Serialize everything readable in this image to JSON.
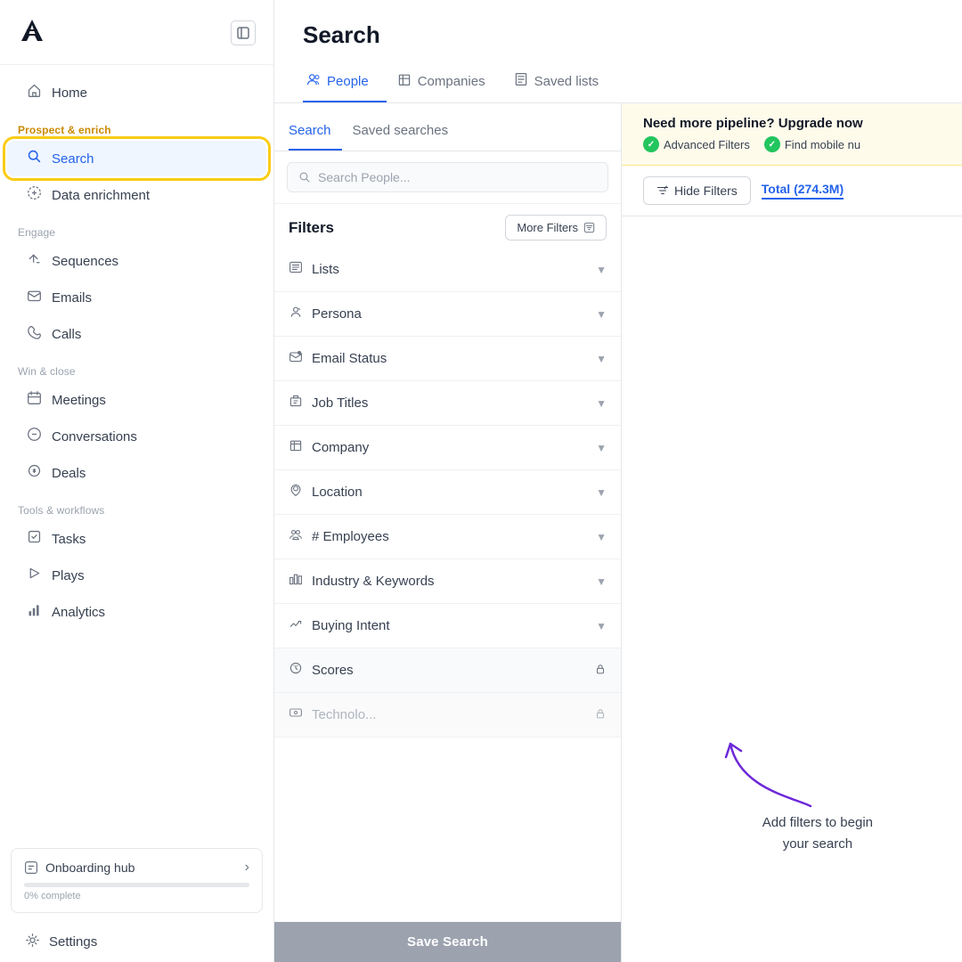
{
  "app": {
    "logo": "A",
    "collapse_icon": "⊟"
  },
  "sidebar": {
    "nav_items": [
      {
        "id": "home",
        "label": "Home",
        "icon": "🏠",
        "section": null,
        "active": false
      },
      {
        "id": "search",
        "label": "Search",
        "icon": "🔍",
        "section": "Prospect & enrich",
        "section_highlight": true,
        "active": true
      },
      {
        "id": "data-enrichment",
        "label": "Data enrichment",
        "icon": "🔄",
        "section": null,
        "active": false
      },
      {
        "id": "sequences",
        "label": "Sequences",
        "icon": "▷",
        "section": "Engage",
        "active": false
      },
      {
        "id": "emails",
        "label": "Emails",
        "icon": "✉",
        "section": null,
        "active": false
      },
      {
        "id": "calls",
        "label": "Calls",
        "icon": "📞",
        "section": null,
        "active": false
      },
      {
        "id": "meetings",
        "label": "Meetings",
        "icon": "📅",
        "section": "Win & close",
        "active": false
      },
      {
        "id": "conversations",
        "label": "Conversations",
        "icon": "💬",
        "section": null,
        "active": false
      },
      {
        "id": "deals",
        "label": "Deals",
        "icon": "$",
        "section": null,
        "active": false
      },
      {
        "id": "tasks",
        "label": "Tasks",
        "icon": "☑",
        "section": "Tools & workflows",
        "active": false
      },
      {
        "id": "plays",
        "label": "Plays",
        "icon": "⚡",
        "section": null,
        "active": false
      },
      {
        "id": "analytics",
        "label": "Analytics",
        "icon": "📊",
        "section": null,
        "active": false
      }
    ],
    "onboarding": {
      "title": "Onboarding hub",
      "progress": 0,
      "progress_label": "0% complete",
      "arrow": "›"
    },
    "settings": {
      "label": "Settings",
      "icon": "⚙"
    }
  },
  "main": {
    "page_title": "Search",
    "tabs": [
      {
        "id": "people",
        "label": "People",
        "icon": "👥",
        "active": true
      },
      {
        "id": "companies",
        "label": "Companies",
        "icon": "🏢",
        "active": false
      },
      {
        "id": "saved-lists",
        "label": "Saved lists",
        "icon": "📋",
        "active": false
      }
    ]
  },
  "filter_panel": {
    "subtabs": [
      {
        "id": "search",
        "label": "Search",
        "active": true
      },
      {
        "id": "saved-searches",
        "label": "Saved searches",
        "active": false
      }
    ],
    "search_placeholder": "Search People...",
    "filters_title": "Filters",
    "more_filters_btn": "More Filters",
    "filters": [
      {
        "id": "lists",
        "label": "Lists",
        "icon": "📋",
        "lock": false
      },
      {
        "id": "persona",
        "label": "Persona",
        "icon": "👤",
        "lock": false
      },
      {
        "id": "email-status",
        "label": "Email Status",
        "icon": "📧",
        "lock": false
      },
      {
        "id": "job-titles",
        "label": "Job Titles",
        "icon": "🏷",
        "lock": false
      },
      {
        "id": "company",
        "label": "Company",
        "icon": "🏢",
        "lock": false
      },
      {
        "id": "location",
        "label": "Location",
        "icon": "📍",
        "lock": false
      },
      {
        "id": "employees",
        "label": "# Employees",
        "icon": "👥",
        "lock": false
      },
      {
        "id": "industry",
        "label": "Industry & Keywords",
        "icon": "🏭",
        "lock": false
      },
      {
        "id": "buying-intent",
        "label": "Buying Intent",
        "icon": "📈",
        "lock": false
      },
      {
        "id": "scores",
        "label": "Scores",
        "icon": "🎯",
        "lock": true
      },
      {
        "id": "technologies",
        "label": "Technologies",
        "icon": "💻",
        "lock": true
      }
    ],
    "save_search_btn": "Save Search"
  },
  "results_panel": {
    "upgrade_text": "Need more pipeline? Upgrade now",
    "badges": [
      {
        "label": "Advanced Filters"
      },
      {
        "label": "Find mobile nu"
      }
    ],
    "hide_filters_btn": "Hide Filters",
    "total_label": "Total (274.3M)",
    "empty_hint_line1": "Add filters to begin",
    "empty_hint_line2": "your search"
  }
}
